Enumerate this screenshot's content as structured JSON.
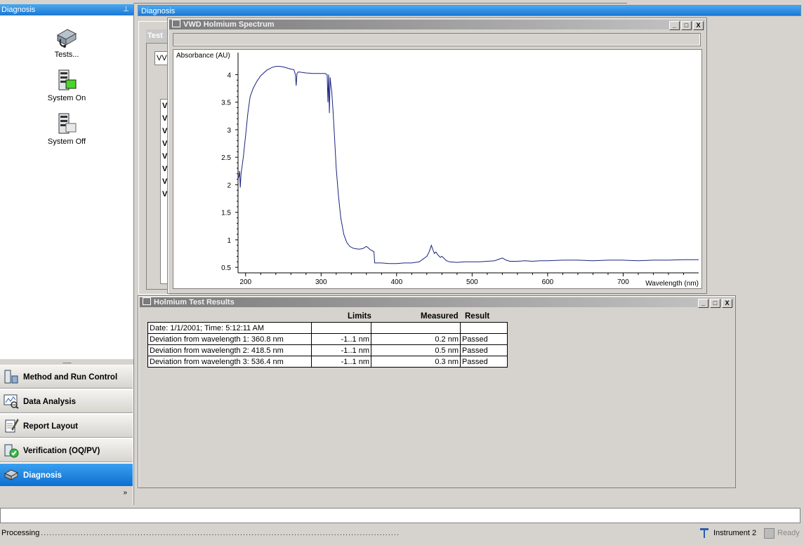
{
  "left_pane": {
    "title": "Diagnosis",
    "tools": [
      {
        "label": "Tests...",
        "icon": "tests-icon"
      },
      {
        "label": "System On",
        "icon": "system-on-icon"
      },
      {
        "label": "System Off",
        "icon": "system-off-icon"
      }
    ],
    "separator": "........",
    "nav": [
      {
        "label": "Method and Run Control",
        "icon": "method-run-icon"
      },
      {
        "label": "Data Analysis",
        "icon": "data-analysis-icon"
      },
      {
        "label": "Report Layout",
        "icon": "report-layout-icon"
      },
      {
        "label": "Verification (OQ/PV)",
        "icon": "verification-icon"
      },
      {
        "label": "Diagnosis",
        "icon": "diagnosis-icon",
        "selected": true
      }
    ],
    "more": "»"
  },
  "main": {
    "title": "Diagnosis",
    "tests_window": {
      "title": "Test",
      "tab": "VV",
      "rows": [
        "V",
        "V",
        "V",
        "V",
        "V",
        "V",
        "V",
        "V",
        "V"
      ]
    },
    "spectrum_window": {
      "title": "VWD Holmium Spectrum",
      "buttons": [
        "_",
        "□",
        "X"
      ]
    },
    "results_window": {
      "title": "Holmium Test Results",
      "headers": {
        "limits": "Limits",
        "measured": "Measured",
        "result": "Result"
      },
      "rows": [
        {
          "label": "Date: 1/1/2001;  Time: 5:12:11 AM",
          "limits": "",
          "measured": "",
          "result": ""
        },
        {
          "label": "Deviation from wavelength 1: 360.8 nm",
          "limits": "-1..1 nm",
          "measured": "0.2 nm",
          "result": "Passed"
        },
        {
          "label": "Deviation from wavelength 2: 418.5 nm",
          "limits": "-1..1 nm",
          "measured": "0.5 nm",
          "result": "Passed"
        },
        {
          "label": "Deviation from wavelength 3: 536.4 nm",
          "limits": "-1..1 nm",
          "measured": "0.3 nm",
          "result": "Passed"
        }
      ]
    }
  },
  "status": {
    "left": "Processing",
    "instrument": "Instrument 2",
    "ready": "Ready"
  },
  "chart_data": {
    "type": "line",
    "title": "",
    "xlabel": "Wavelength (nm)",
    "ylabel": "Absorbance (AU)",
    "xlim": [
      190,
      800
    ],
    "ylim": [
      0.4,
      4.4
    ],
    "x_ticks": [
      200,
      300,
      400,
      500,
      600,
      700
    ],
    "y_ticks": [
      0.5,
      1,
      1.5,
      2,
      2.5,
      3,
      3.5,
      4
    ],
    "x_tick_labels": [
      "200",
      "300",
      "400",
      "500",
      "600",
      "700"
    ],
    "y_tick_labels": [
      "0.5",
      "1",
      "1.5",
      "2",
      "2.5",
      "3",
      "3.5",
      "4"
    ],
    "grid": false,
    "color": "#1a237e",
    "series": [
      {
        "x": [
          190,
          191,
          192,
          193,
          194,
          195,
          197,
          200,
          203,
          206,
          210,
          215,
          220,
          228,
          235,
          240,
          245,
          250,
          255,
          260,
          264,
          266,
          267,
          268,
          270,
          275,
          280,
          290,
          300,
          305,
          308,
          309,
          310,
          311,
          312,
          313,
          314,
          316,
          318,
          320,
          323,
          326,
          330,
          334,
          338,
          342,
          345,
          350,
          355,
          360,
          362,
          365,
          368,
          370,
          371,
          375,
          380,
          390,
          400,
          410,
          420,
          430,
          440,
          443,
          446,
          448,
          450,
          452,
          455,
          458,
          460,
          463,
          466,
          470,
          480,
          490,
          500,
          510,
          520,
          530,
          536,
          540,
          545,
          550,
          560,
          570,
          580,
          590,
          600,
          620,
          640,
          660,
          680,
          700,
          720,
          740,
          760,
          780,
          800
        ],
        "y": [
          2.1,
          2.15,
          2.25,
          1.95,
          2.2,
          2.3,
          2.5,
          2.9,
          3.3,
          3.6,
          3.75,
          3.88,
          3.98,
          4.08,
          4.13,
          4.15,
          4.15,
          4.14,
          4.12,
          4.1,
          4.09,
          4.0,
          3.8,
          4.02,
          4.05,
          4.04,
          4.03,
          4.02,
          4.02,
          4.02,
          4.0,
          3.5,
          4.0,
          3.3,
          3.95,
          3.8,
          3.7,
          3.3,
          2.8,
          2.3,
          1.8,
          1.4,
          1.1,
          0.95,
          0.88,
          0.85,
          0.84,
          0.83,
          0.84,
          0.88,
          0.86,
          0.82,
          0.8,
          0.78,
          0.58,
          0.58,
          0.58,
          0.57,
          0.57,
          0.58,
          0.58,
          0.6,
          0.7,
          0.78,
          0.9,
          0.82,
          0.75,
          0.78,
          0.72,
          0.68,
          0.7,
          0.66,
          0.62,
          0.6,
          0.59,
          0.6,
          0.6,
          0.6,
          0.61,
          0.62,
          0.65,
          0.67,
          0.63,
          0.61,
          0.61,
          0.62,
          0.61,
          0.62,
          0.62,
          0.63,
          0.63,
          0.62,
          0.63,
          0.63,
          0.62,
          0.63,
          0.63,
          0.64,
          0.64
        ]
      }
    ]
  }
}
